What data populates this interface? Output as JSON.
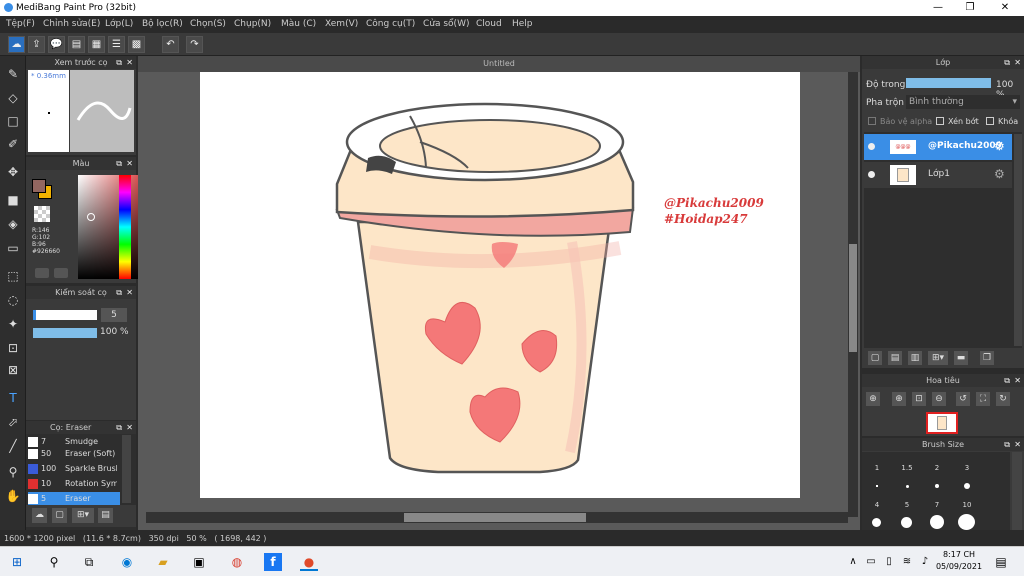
{
  "window": {
    "title": "MediBang Paint Pro (32bit)"
  },
  "menu": [
    "Tệp(F)",
    "Chỉnh sửa(E)",
    "Lớp(L)",
    "Bộ lọc(R)",
    "Chọn(S)",
    "Chụp(N)",
    "Màu (C)",
    "Xem(V)",
    "Công cụ(T)",
    "Cửa sổ(W)",
    "Cloud",
    "Help"
  ],
  "canvas": {
    "tab_title": "Untitled",
    "watermark_line1": "@Pikachu2009",
    "watermark_line2": "#Hoidap247"
  },
  "brush_preview": {
    "title": "Xem trước cọ",
    "size": "* 0.36mm"
  },
  "color": {
    "title": "Màu",
    "r": "R:146",
    "g": "G:102",
    "b": "B:96",
    "hex": "#926660",
    "primary": "#926660",
    "secondary": "#f2b200"
  },
  "brush_control": {
    "title": "Kiểm soát cọ",
    "size_value": "5",
    "opacity_value": "100 %"
  },
  "brush_list": {
    "title": "Cọ: Eraser",
    "items": [
      {
        "n": "7",
        "name": "Smudge",
        "color": "#ffffff"
      },
      {
        "n": "50",
        "name": "Eraser (Soft)",
        "color": "#ffffff"
      },
      {
        "n": "100",
        "name": "Sparkle Brush",
        "color": "#3a5bd8"
      },
      {
        "n": "10",
        "name": "Rotation Sym",
        "color": "#e03030"
      },
      {
        "n": "5",
        "name": "Eraser",
        "color": "#ffffff"
      }
    ]
  },
  "layers": {
    "title": "Lớp",
    "opacity_label": "Độ trong",
    "opacity_value": "100 %",
    "blend_label": "Pha trộn",
    "blend_value": "Bình thường",
    "protect_alpha": "Bảo vệ alpha",
    "clipping": "Xén bớt",
    "lock": "Khóa",
    "items": [
      {
        "name": "@Pikachu2009"
      },
      {
        "name": "Lớp1"
      }
    ]
  },
  "navigator": {
    "title": "Hoa tiêu"
  },
  "brush_size": {
    "title": "Brush Size",
    "labels": [
      "1",
      "1.5",
      "2",
      "3",
      "4",
      "5",
      "7",
      "10"
    ]
  },
  "status": {
    "text": "1600 * 1200 pixel   (11.6 * 8.7cm)   350 dpi   50 %   ( 1698, 442 )"
  },
  "taskbar": {
    "time": "8:17 CH",
    "date": "05/09/2021"
  }
}
